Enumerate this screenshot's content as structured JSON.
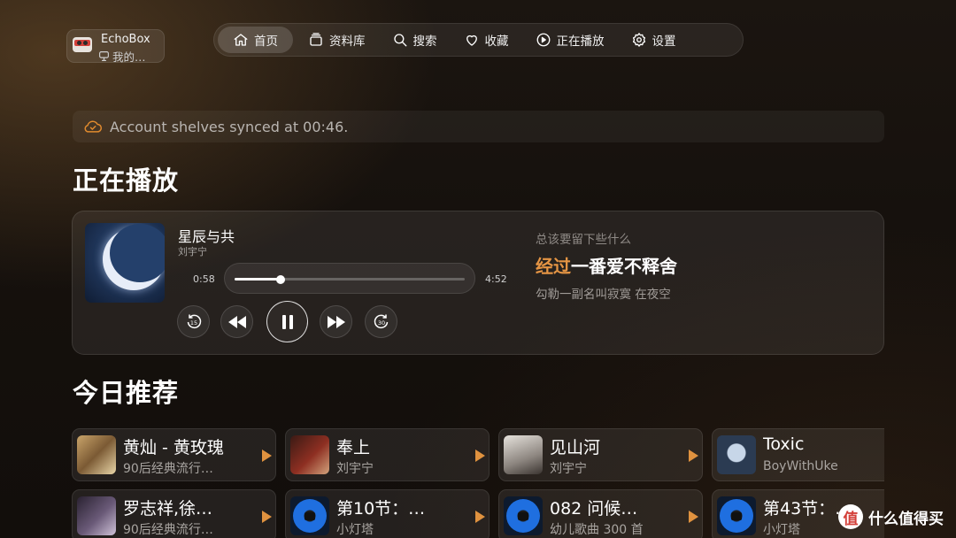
{
  "app": {
    "name": "EchoBox",
    "user": "我的…"
  },
  "nav": [
    {
      "label": "首页",
      "icon": "home-icon",
      "active": true
    },
    {
      "label": "资料库",
      "icon": "library-icon",
      "active": false
    },
    {
      "label": "搜索",
      "icon": "search-icon",
      "active": false
    },
    {
      "label": "收藏",
      "icon": "heart-icon",
      "active": false
    },
    {
      "label": "正在播放",
      "icon": "play-circle-icon",
      "active": false
    },
    {
      "label": "设置",
      "icon": "gear-icon",
      "active": false
    }
  ],
  "sync": {
    "icon": "cloud-check-icon",
    "message": "Account shelves synced at 00:46."
  },
  "now_playing": {
    "section_title": "正在播放",
    "title": "星辰与共",
    "artist": "刘宇宁",
    "elapsed": "0:58",
    "total": "4:52",
    "progress": 0.199,
    "skip_back_label": "15",
    "skip_forward_label": "30",
    "lyrics": {
      "previous": "总该要留下些什么",
      "current_sung": "经过",
      "current_rest": "一番爱不释舍",
      "next": "勾勒一副名叫寂寞 在夜空"
    }
  },
  "recommendations": {
    "section_title": "今日推荐",
    "items": [
      {
        "title": "黄灿 - 黄玫瑰",
        "subtitle": "90后经典流行…",
        "thumb": "photo-warm"
      },
      {
        "title": "奉上",
        "subtitle": "刘宇宁",
        "thumb": "photo-red"
      },
      {
        "title": "见山河",
        "subtitle": "刘宇宁",
        "thumb": "photo-gray"
      },
      {
        "title": "Toxic",
        "subtitle": "BoyWithUke",
        "thumb": "photo-blue"
      },
      {
        "title": "罗志祥,徐…",
        "subtitle": "90后经典流行…",
        "thumb": "photo-purple"
      },
      {
        "title": "第10节：…",
        "subtitle": "小灯塔",
        "thumb": "disc"
      },
      {
        "title": "082 问候…",
        "subtitle": "幼儿歌曲 300 首",
        "thumb": "disc"
      },
      {
        "title": "第43节：…",
        "subtitle": "小灯塔",
        "thumb": "disc"
      }
    ]
  },
  "watermark": {
    "logo": "值",
    "text": "什么值得买"
  },
  "colors": {
    "accent": "#e59544",
    "play_arrow": "#e0923f",
    "sync_icon": "#e08a2e"
  }
}
